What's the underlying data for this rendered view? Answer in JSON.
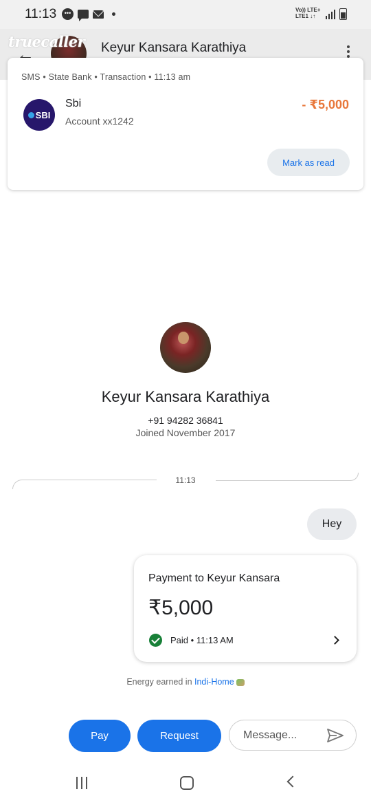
{
  "status_bar": {
    "time": "11:13",
    "network_line1": "Vo)) LTE+",
    "network_line2": "LTE1 ↓↑"
  },
  "header": {
    "app_logo_text": "truecaller",
    "title": "Keyur Kansara Karathiya"
  },
  "sms_notification": {
    "meta": "SMS • State Bank • Transaction • 11:13 am",
    "logo_text": "SBI",
    "sender": "Sbi",
    "account": "Account xx1242",
    "amount": "- ₹5,000",
    "mark_read_label": "Mark as read",
    "amount_color": "#e8773a"
  },
  "profile": {
    "name": "Keyur Kansara Karathiya",
    "phone": "+91 94282 36841",
    "joined": "Joined November 2017"
  },
  "conversation": {
    "divider_time": "11:13",
    "messages": [
      {
        "text": "Hey"
      }
    ],
    "payment": {
      "title": "Payment to Keyur Kansara",
      "amount": "₹5,000",
      "status": "Paid • 11:13 AM",
      "status_color": "#188038"
    },
    "energy_prefix": "Energy earned in ",
    "energy_link": "Indi-Home"
  },
  "composer": {
    "pay_label": "Pay",
    "request_label": "Request",
    "message_placeholder": "Message..."
  },
  "colors": {
    "accent": "#1a73e8",
    "bubble": "#e9ebee"
  }
}
